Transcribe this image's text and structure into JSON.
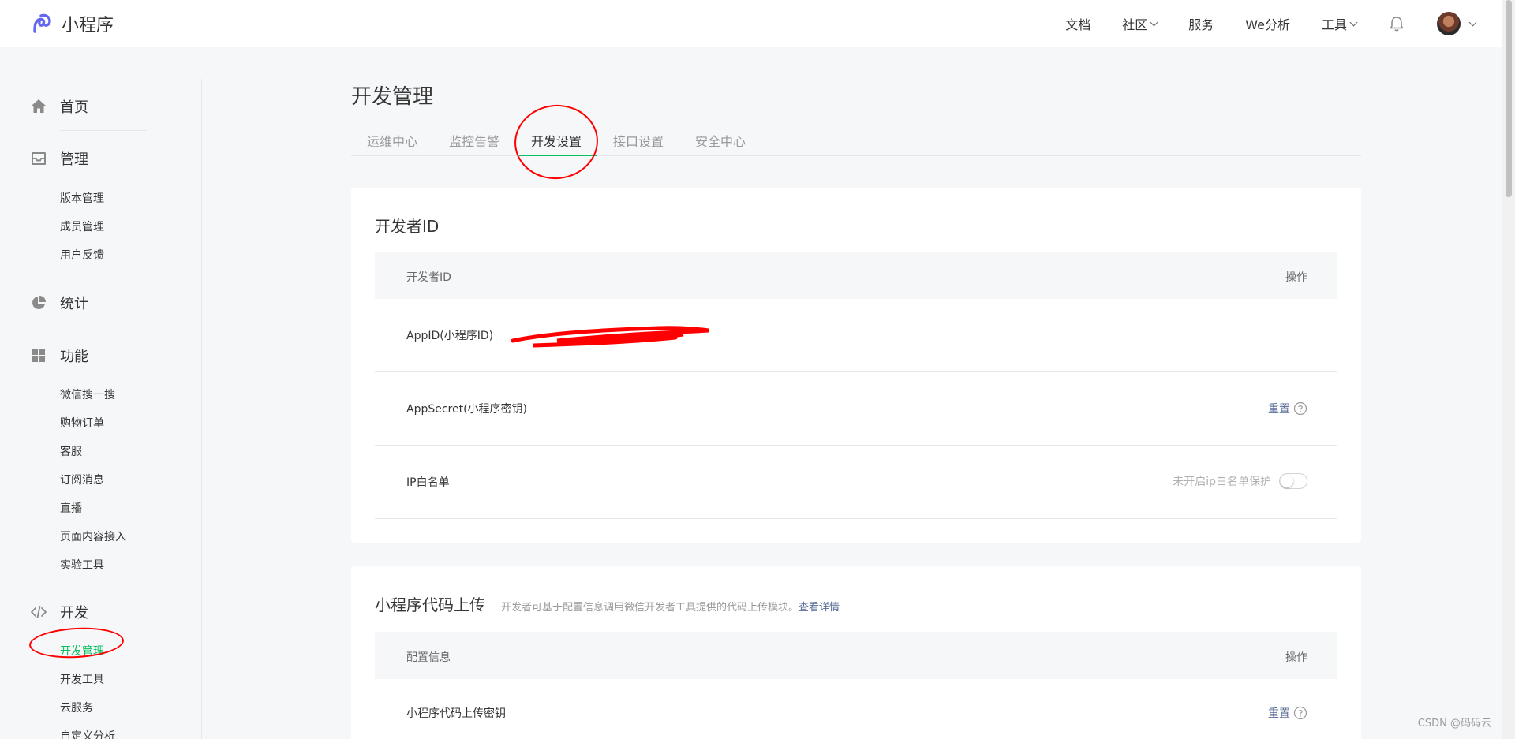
{
  "header": {
    "logo_text": "小程序",
    "nav": [
      {
        "label": "文档",
        "has_dropdown": false
      },
      {
        "label": "社区",
        "has_dropdown": true
      },
      {
        "label": "服务",
        "has_dropdown": false
      },
      {
        "label": "We分析",
        "has_dropdown": false
      },
      {
        "label": "工具",
        "has_dropdown": true
      }
    ],
    "icons": {
      "bell": "bell-icon",
      "avatar": "user-avatar"
    }
  },
  "sidebar": {
    "home": "首页",
    "manage": {
      "label": "管理",
      "items": [
        "版本管理",
        "成员管理",
        "用户反馈"
      ]
    },
    "stats": "统计",
    "features": {
      "label": "功能",
      "items": [
        "微信搜一搜",
        "购物订单",
        "客服",
        "订阅消息",
        "直播",
        "页面内容接入",
        "实验工具"
      ]
    },
    "dev": {
      "label": "开发",
      "items": [
        "开发管理",
        "开发工具",
        "云服务",
        "自定义分析"
      ],
      "active": "开发管理"
    }
  },
  "main": {
    "title": "开发管理",
    "tabs": [
      "运维中心",
      "监控告警",
      "开发设置",
      "接口设置",
      "安全中心"
    ],
    "active_tab": "开发设置",
    "developer_id": {
      "title": "开发者ID",
      "col_id": "开发者ID",
      "col_action": "操作",
      "rows": {
        "appid": "AppID(小程序ID)",
        "appsecret": "AppSecret(小程序密钥)",
        "appsecret_action": "重置",
        "ip_whitelist": "IP白名单",
        "ip_status": "未开启ip白名单保护",
        "ip_enabled": false
      }
    },
    "code_upload": {
      "title": "小程序代码上传",
      "desc": "开发者可基于配置信息调用微信开发者工具提供的代码上传模块。",
      "link": "查看详情",
      "col_config": "配置信息",
      "col_action": "操作",
      "row_key": "小程序代码上传密钥",
      "row_action": "重置"
    }
  },
  "watermark": "CSDN @码码云",
  "colors": {
    "accent_green": "#07c160",
    "link_blue": "#576b95",
    "annotation_red": "#ff0000",
    "logo_purple": "#6467f0"
  }
}
